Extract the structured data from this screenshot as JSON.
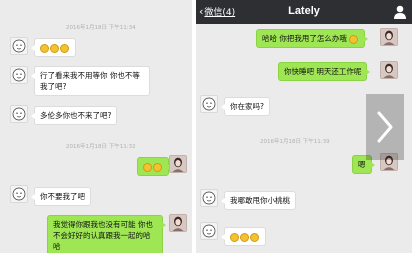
{
  "left_panel": {
    "timestamps": {
      "ts1": "2016年1月18日 下午11:34",
      "ts2": "2016年1月18日 下午11:32"
    },
    "messages": [
      {
        "side": "in",
        "text": ""
      },
      {
        "side": "in",
        "text": "行了看来我不用等你 你也不等我了吧?"
      },
      {
        "side": "in",
        "text": "多伦多你也不来了吧?"
      },
      {
        "side": "out",
        "text": ""
      },
      {
        "side": "in",
        "text": "你不要我了吧"
      },
      {
        "side": "out",
        "text": "我觉得你跟我也没有可能 你也不会好好的认真跟我一起的哈哈"
      }
    ]
  },
  "right_panel": {
    "header": {
      "back_label": "微信(4)",
      "title": "Lately"
    },
    "timestamps": {
      "ts1": "2016年1月18日 下午11:39"
    },
    "messages": [
      {
        "side": "out",
        "text": "哈哈 你把我甩了怎么办哦"
      },
      {
        "side": "out",
        "text": "你快睡吧 明天还工作呢"
      },
      {
        "side": "in",
        "text": "你在家吗?"
      },
      {
        "side": "out",
        "text": "嗯"
      },
      {
        "side": "in",
        "text": "我哪敢甩你小桃桃"
      },
      {
        "side": "in",
        "text": ""
      }
    ]
  },
  "icons": {
    "back": "chevron-left-icon",
    "profile": "person-icon",
    "next": "chevron-right-icon",
    "emoji": "smiley-emoji-icon"
  },
  "colors": {
    "titlebar": "#2e2f33",
    "chat_bg": "#ebebeb",
    "bubble_out": "#9ee653",
    "bubble_in": "#ffffff"
  }
}
